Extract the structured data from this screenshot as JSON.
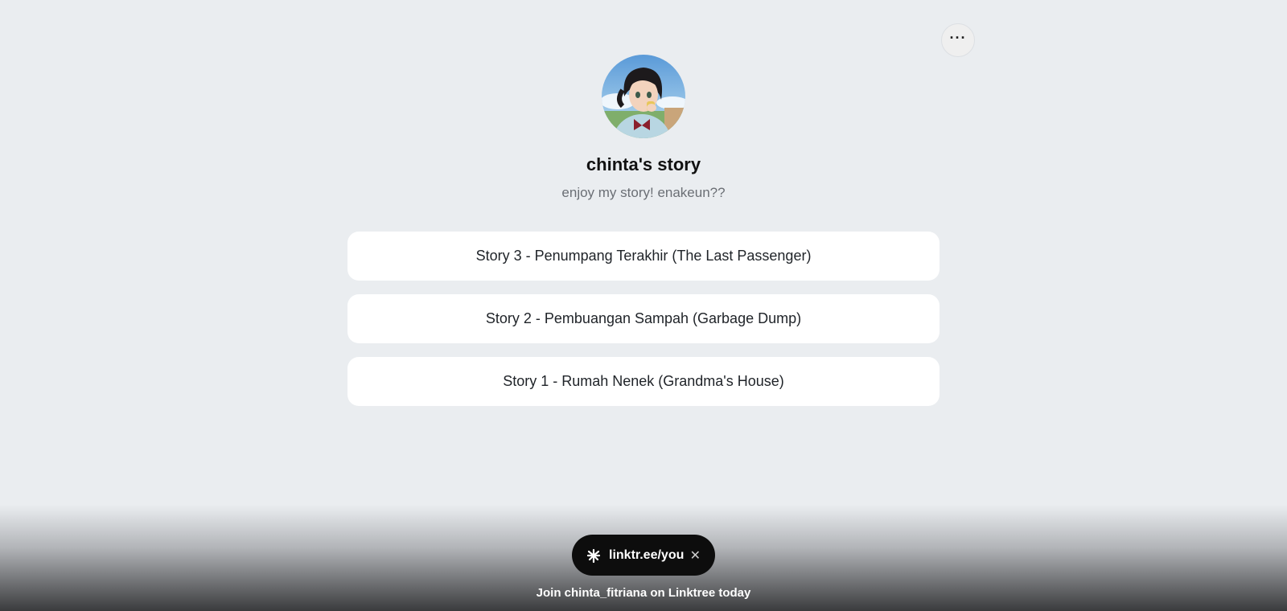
{
  "header": {
    "more_label": "···"
  },
  "profile": {
    "name": "chinta's story",
    "bio": "enjoy my story! enakeun??"
  },
  "links": [
    {
      "label": "Story 3 - Penumpang Terakhir (The Last Passenger)"
    },
    {
      "label": "Story 2 - Pembuangan Sampah (Garbage Dump)"
    },
    {
      "label": "Story 1 - Rumah Nenek (Grandma's House)"
    }
  ],
  "footer": {
    "pill_label": "linktr.ee/you",
    "close_label": "✕",
    "join_text": "Join chinta_fitriana on Linktree today"
  },
  "icons": {
    "more": "more-dots-icon",
    "logo": "linktree-logo-icon",
    "close": "close-icon"
  },
  "colors": {
    "background": "#eaedf0",
    "card": "#ffffff",
    "pill": "#0d0d0d"
  }
}
